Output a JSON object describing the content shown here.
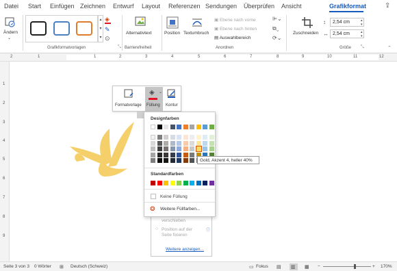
{
  "tabs": [
    "Datei",
    "Start",
    "Einfügen",
    "Zeichnen",
    "Entwurf",
    "Layout",
    "Referenzen",
    "Sendungen",
    "Überprüfen",
    "Ansicht",
    "Grafikformat"
  ],
  "ribbon": {
    "aendern_label": "Ändern",
    "group_styles_label": "Grafikformatvorlagen",
    "alt_text_label": "Alternativtext",
    "group_accessibility_label": "Barrierefreiheit",
    "position_label": "Position",
    "wrap_text_label": "Textumbruch",
    "bring_forward_label": "Ebene nach vorne",
    "send_backward_label": "Ebene nach hinten",
    "selection_pane_label": "Auswahlbereich",
    "group_arrange_label": "Anordnen",
    "crop_label": "Zuschneiden",
    "height_value": "2,54 cm",
    "width_value": "2,54 cm",
    "group_size_label": "Größe",
    "style_colors": [
      "#1f1f1f",
      "#4a7fc1",
      "#e07b2a"
    ]
  },
  "ruler": {
    "h_numbers": [
      "2",
      "1",
      "1",
      "2",
      "3",
      "4",
      "5",
      "6",
      "7",
      "8",
      "9",
      "10",
      "11",
      "12"
    ],
    "v_numbers": [
      "1",
      "2",
      "3",
      "4",
      "5",
      "6",
      "7",
      "8",
      "9"
    ]
  },
  "minibar": {
    "style_label": "Formatvorlage",
    "fill_label": "Füllung",
    "outline_label": "Kontur",
    "fill_color": "#e81123"
  },
  "colorpop": {
    "theme_heading": "Designfarben",
    "theme_top": [
      "#ffffff",
      "#000000",
      "#e7e6e6",
      "#44546a",
      "#4472c4",
      "#ed7d31",
      "#a5a5a5",
      "#ffc000",
      "#5b9bd5",
      "#70ad47"
    ],
    "theme_columns": [
      [
        "#f2f2f2",
        "#d9d9d9",
        "#bfbfbf",
        "#a6a6a6",
        "#7f7f7f"
      ],
      [
        "#7f7f7f",
        "#595959",
        "#404040",
        "#262626",
        "#0d0d0d"
      ],
      [
        "#d0cece",
        "#aeabab",
        "#757171",
        "#3a3838",
        "#171616"
      ],
      [
        "#d6dce4",
        "#adb9ca",
        "#8497b0",
        "#333f4f",
        "#222a35"
      ],
      [
        "#dae3f3",
        "#b4c7e7",
        "#8faadc",
        "#2f5597",
        "#1f3864"
      ],
      [
        "#fbe5d6",
        "#f8cbad",
        "#f4b183",
        "#c55a11",
        "#843c0c"
      ],
      [
        "#ededed",
        "#dbdbdb",
        "#c9c9c9",
        "#7b7b7b",
        "#525252"
      ],
      [
        "#fff2cc",
        "#ffe699",
        "#ffd966",
        "#bf9000",
        "#7f6000"
      ],
      [
        "#deebf7",
        "#bdd7ee",
        "#9dc3e6",
        "#2e75b6",
        "#1f4e79"
      ],
      [
        "#e2f0d9",
        "#c5e0b4",
        "#a9d18e",
        "#548235",
        "#385723"
      ]
    ],
    "standard_heading": "Standardfarben",
    "standard": [
      "#c00000",
      "#ff0000",
      "#ffc000",
      "#ffff00",
      "#92d050",
      "#00b050",
      "#00b0f0",
      "#0070c0",
      "#002060",
      "#7030a0"
    ],
    "no_fill_label": "Keine Füllung",
    "more_colors_label": "Weitere Füllfarben..."
  },
  "tooltip": "Gold, Akzent 4, heller 40%",
  "layout_panel": {
    "item1": "verschieben",
    "item2_line1": "Position auf der",
    "item2_line2": "Seite fixieren",
    "more_link": "Weitere anzeigen..."
  },
  "banana_color": "#f5cf6a",
  "status": {
    "page": "Seite 3 von 3",
    "words": "0 Wörter",
    "language": "Deutsch (Schweiz)",
    "focus": "Fokus",
    "zoom": "170%"
  }
}
